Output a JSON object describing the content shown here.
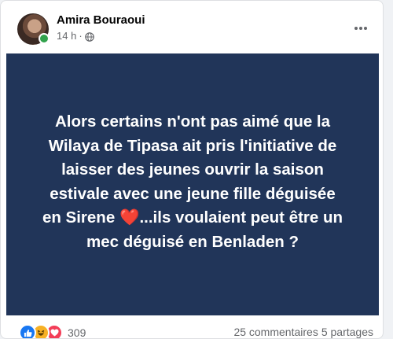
{
  "post": {
    "author": "Amira Bouraoui",
    "time": "14 h",
    "separator": "·",
    "text_lines": [
      "Alors certains n'ont pas aimé que la",
      "Wilaya de Tipasa ait pris l'initiative de",
      "laisser des jeunes ouvrir la saison",
      "estivale avec une jeune fille déguisée",
      "en Sirene ",
      "...ils voulaient peut être un",
      "mec déguisé en Benladen ?"
    ],
    "heart_emoji": "❤️"
  },
  "footer": {
    "reaction_count": "309",
    "comments": "25 commentaires",
    "shares": "5 partages"
  },
  "icons": {
    "more": "more-options-icon",
    "globe": "globe-icon",
    "like": "like-reaction-icon",
    "haha": "haha-reaction-icon",
    "love": "love-reaction-icon"
  },
  "colors": {
    "banner_bg": "#213559",
    "heart": "#e41e3f",
    "online": "#31a24c",
    "like": "#1877f2"
  }
}
